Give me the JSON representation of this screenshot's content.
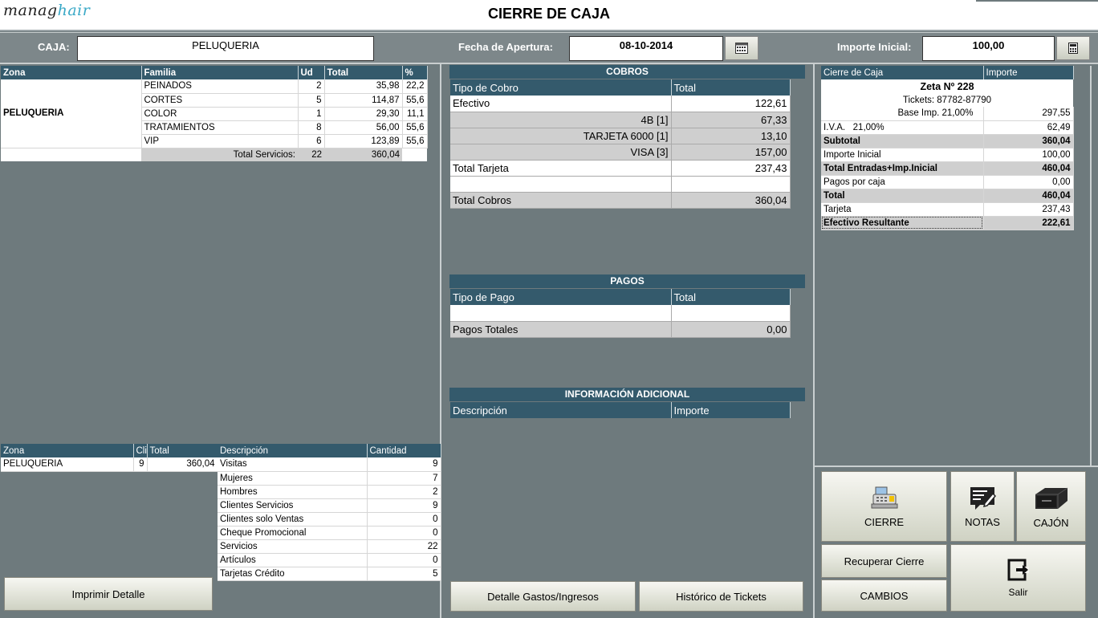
{
  "app": {
    "logo_main": "manag",
    "logo_accent": "hair",
    "title": "CIERRE DE CAJA"
  },
  "header": {
    "caja_label": "CAJA:",
    "caja_value": "PELUQUERIA",
    "fecha_label": "Fecha de Apertura:",
    "fecha_value": "08-10-2014",
    "importe_label": "Importe Inicial:",
    "importe_value": "100,00"
  },
  "familias": {
    "headers": [
      "Zona",
      "Familia",
      "Ud",
      "Total",
      "%"
    ],
    "zona": "PELUQUERIA",
    "rows": [
      {
        "familia": "PEINADOS",
        "ud": "2",
        "total": "35,98",
        "pct": "22,2"
      },
      {
        "familia": "CORTES",
        "ud": "5",
        "total": "114,87",
        "pct": "55,6"
      },
      {
        "familia": "COLOR",
        "ud": "1",
        "total": "29,30",
        "pct": "11,1"
      },
      {
        "familia": "TRATAMIENTOS",
        "ud": "8",
        "total": "56,00",
        "pct": "55,6"
      },
      {
        "familia": "VIP",
        "ud": "6",
        "total": "123,89",
        "pct": "55,6"
      }
    ],
    "total_label": "Total Servicios:",
    "total_ud": "22",
    "total_value": "360,04"
  },
  "zonas": {
    "headers": [
      "Zona",
      "Cli",
      "Total"
    ],
    "rows": [
      {
        "zona": "PELUQUERIA",
        "cli": "9",
        "total": "360,04"
      }
    ]
  },
  "stats": {
    "headers": [
      "Descripción",
      "Cantidad"
    ],
    "rows": [
      {
        "desc": "Visitas",
        "qty": "9"
      },
      {
        "desc": "Mujeres",
        "qty": "7"
      },
      {
        "desc": "Hombres",
        "qty": "2"
      },
      {
        "desc": "Clientes Servicios",
        "qty": "9"
      },
      {
        "desc": "Clientes solo Ventas",
        "qty": "0"
      },
      {
        "desc": "Cheque Promocional",
        "qty": "0"
      },
      {
        "desc": "Servicios",
        "qty": "22"
      },
      {
        "desc": "Artículos",
        "qty": "0"
      },
      {
        "desc": "Tarjetas Crédito",
        "qty": "5"
      }
    ]
  },
  "cobros": {
    "title": "COBROS",
    "headers": [
      "Tipo de Cobro",
      "Total"
    ],
    "efectivo_label": "Efectivo",
    "efectivo_value": "122,61",
    "cards": [
      {
        "label": "4B [1]",
        "value": "67,33"
      },
      {
        "label": "TARJETA 6000 [1]",
        "value": "13,10"
      },
      {
        "label": "VISA [3]",
        "value": "157,00"
      }
    ],
    "tarjeta_label": "Total Tarjeta",
    "tarjeta_value": "237,43",
    "total_label": "Total Cobros",
    "total_value": "360,04"
  },
  "pagos": {
    "title": "PAGOS",
    "headers": [
      "Tipo de Pago",
      "Total"
    ],
    "total_label": "Pagos Totales",
    "total_value": "0,00"
  },
  "info": {
    "title": "INFORMACIÓN ADICIONAL",
    "headers": [
      "Descripción",
      "Importe"
    ]
  },
  "cierre": {
    "headers": [
      "Cierre de Caja",
      "Importe"
    ],
    "zeta": "Zeta Nº 228",
    "tickets": "Tickets:  87782-87790",
    "rows": [
      {
        "label": "Base Imp. 21,00%",
        "value": "297,55",
        "style": "right"
      },
      {
        "label": "I.V.A.   21,00%",
        "value": "62,49",
        "style": "plain"
      },
      {
        "label": "Subtotal",
        "value": "360,04",
        "style": "bold"
      },
      {
        "label": "Importe Inicial",
        "value": "100,00",
        "style": "plain"
      },
      {
        "label": "Total Entradas+Imp.Inicial",
        "value": "460,04",
        "style": "bold"
      },
      {
        "label": "Pagos por caja",
        "value": "0,00",
        "style": "plain"
      },
      {
        "label": "Total",
        "value": "460,04",
        "style": "bold"
      },
      {
        "label": "Tarjeta",
        "value": "237,43",
        "style": "plain"
      },
      {
        "label": "Efectivo Resultante",
        "value": "222,61",
        "style": "bold"
      }
    ]
  },
  "buttons": {
    "imprimir": "Imprimir Detalle",
    "detalle": "Detalle Gastos/Ingresos",
    "historico": "Histórico de Tickets",
    "cierre": "CIERRE",
    "notas": "NOTAS",
    "cajon": "CAJÓN",
    "recuperar": "Recuperar Cierre",
    "cambios": "CAMBIOS",
    "salir": "Salir"
  }
}
